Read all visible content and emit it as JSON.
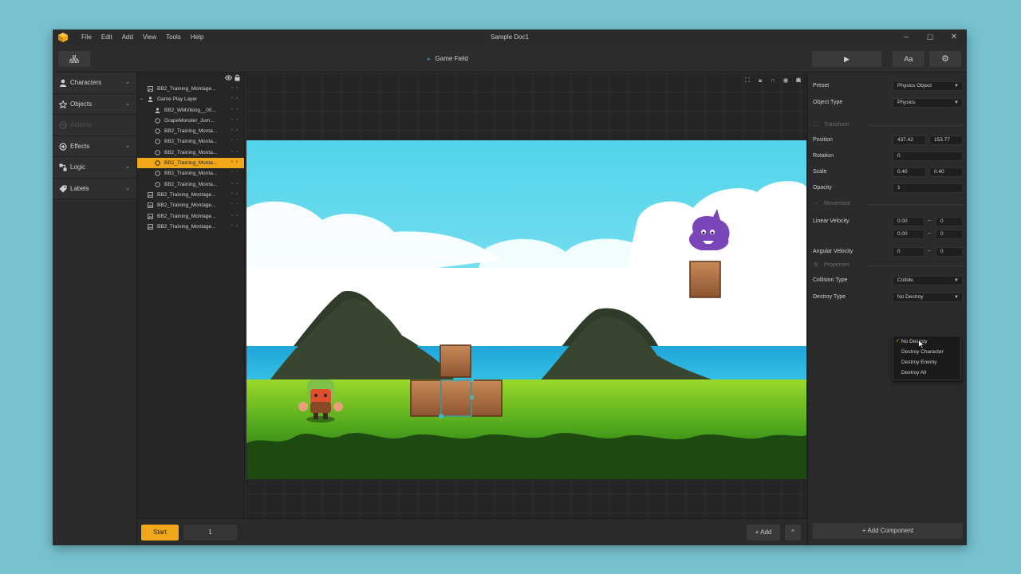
{
  "window": {
    "title": "Sample Doc1",
    "controls": {
      "minimize": "–",
      "maximize": "☐",
      "close": "✕"
    }
  },
  "menu": [
    "File",
    "Edit",
    "Add",
    "View",
    "Tools",
    "Help"
  ],
  "toolbar": {
    "panel_title": "Game Field",
    "play": "▶",
    "text_tool": "Aa",
    "settings": "⚙",
    "hierarchy": "⊞"
  },
  "sidebar": {
    "items": [
      {
        "label": "Characters",
        "icon": "person-icon",
        "chevron": "⌄"
      },
      {
        "label": "Objects",
        "icon": "star-icon",
        "chevron": "⌄"
      },
      {
        "label": "Actions",
        "icon": "actions-icon",
        "chevron": ""
      },
      {
        "label": "Effects",
        "icon": "effects-icon",
        "chevron": "⌄"
      },
      {
        "label": "Logic",
        "icon": "logic-icon",
        "chevron": "⌄"
      },
      {
        "label": "Labels",
        "icon": "tag-icon",
        "chevron": "⌄"
      }
    ]
  },
  "layers": {
    "rows": [
      {
        "label": "BB2_Training_Montage..."
      },
      {
        "label": "Game Play Layer"
      },
      {
        "label": "BB2_WMViking__00..."
      },
      {
        "label": "GrapeMonster_Jum..."
      },
      {
        "label": "BB2_Training_Monta..."
      },
      {
        "label": "BB2_Training_Monta..."
      },
      {
        "label": "BB2_Training_Monta..."
      },
      {
        "label": "BB2_Training_Monta..."
      },
      {
        "label": "BB2_Training_Monta..."
      },
      {
        "label": "BB2_Training_Monta..."
      },
      {
        "label": "BB2_Training_Montage..."
      },
      {
        "label": "BB2_Training_Montage..."
      },
      {
        "label": "BB2_Training_Montage..."
      },
      {
        "label": "BB2_Training_Montage..."
      }
    ],
    "footer": {
      "folder": "▬",
      "trash": "🗑"
    }
  },
  "bottom": {
    "start": "Start",
    "frame": "1",
    "add": "+ Add",
    "up": "^"
  },
  "inspector": {
    "preset": {
      "label": "Preset",
      "value": "Physics Object"
    },
    "object_type": {
      "label": "Object Type",
      "value": "Physics"
    },
    "transform_section": "Transform",
    "position": {
      "label": "Position",
      "x": "437.42",
      "y": "153.77"
    },
    "rotation": {
      "label": "Rotation",
      "value": "0"
    },
    "scale": {
      "label": "Scale",
      "x": "0.40",
      "y": "0.40"
    },
    "opacity": {
      "label": "Opacity",
      "value": "1"
    },
    "movement_section": "Movement",
    "linear_velocity": {
      "label": "Linear Velocity",
      "a1": "0.00",
      "b1": "0",
      "a2": "0.00",
      "b2": "0"
    },
    "angular_velocity": {
      "label": "Angular Velocity",
      "a": "0",
      "b": "0"
    },
    "properties_section": "Properties",
    "collision_type": {
      "label": "Collision Type",
      "value": "Collide"
    },
    "destroy_type": {
      "label": "Destroy Type",
      "value": "No Destroy",
      "options": [
        "No Destroy",
        "Destroy Character",
        "Destroy Enemy",
        "Destroy All"
      ]
    },
    "add_component": "+ Add Component",
    "tilde": "~"
  },
  "colors": {
    "accent": "#f0a81a",
    "selection": "#3fb6c9"
  }
}
